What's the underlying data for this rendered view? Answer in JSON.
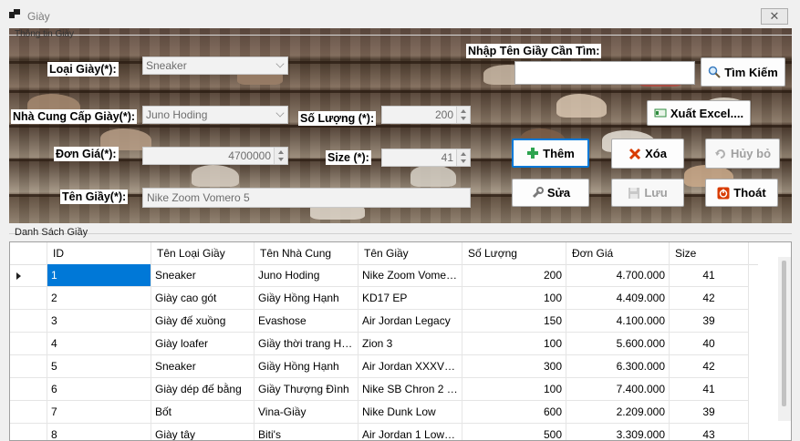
{
  "window": {
    "title": "Giày",
    "close_label": "✕"
  },
  "info_group": {
    "title": "Thông tin Giày"
  },
  "form": {
    "loai_giay_label": "Loại Giày(*):",
    "loai_giay_value": "Sneaker",
    "nha_cung_cap_label": "Nhà Cung Cấp Giày(*):",
    "nha_cung_cap_value": "Juno Hoding",
    "so_luong_label": "Số Lượng (*):",
    "so_luong_value": "200",
    "don_gia_label": "Đơn Giá(*):",
    "don_gia_value": "4700000",
    "size_label": "Size (*):",
    "size_value": "41",
    "ten_giay_label": "Tên Giầy(*):",
    "ten_giay_value": "Nike Zoom Vomero 5"
  },
  "search": {
    "label": "Nhập Tên Giầy Cần Tìm:",
    "value": "",
    "button": "Tìm Kiếm"
  },
  "buttons": {
    "export": "Xuất Excel....",
    "add": "Thêm",
    "delete": "Xóa",
    "cancel": "Hủy bỏ",
    "edit": "Sửa",
    "save": "Lưu",
    "exit": "Thoát"
  },
  "colors": {
    "selection": "#0078d7",
    "add_icon": "#2ea44f",
    "delete_icon": "#d83b01",
    "exit_icon": "#d83b01"
  },
  "table": {
    "title": "Danh Sách Giầy",
    "columns": [
      "ID",
      "Tên Loại Giầy",
      "Tên Nhà Cung",
      "Tên Giầy",
      "Số Lượng",
      "Đơn Giá",
      "Size"
    ],
    "rows": [
      [
        "1",
        "Sneaker",
        "Juno Hoding",
        "Nike Zoom Vomer...",
        "200",
        "4.700.000",
        "41"
      ],
      [
        "2",
        "Giày cao gót",
        "Giầy Hồng Hạnh",
        "KD17 EP",
        "100",
        "4.409.000",
        "42"
      ],
      [
        "3",
        "Giày đế xuồng",
        "Evashose",
        "Air Jordan Legacy",
        "150",
        "4.100.000",
        "39"
      ],
      [
        "4",
        "Giày loafer",
        "Giầy thời trang Hạ...",
        "Zion 3",
        "100",
        "5.600.000",
        "40"
      ],
      [
        "5",
        "Sneaker",
        "Giầy Hồng Hạnh",
        "Air Jordan XXXVIII ...",
        "300",
        "6.300.000",
        "42"
      ],
      [
        "6",
        "Giày dép đế bằng",
        "Giầy Thượng Đình",
        "Nike SB Chron 2 C...",
        "100",
        "7.400.000",
        "41"
      ],
      [
        "7",
        "Bốt",
        "Vina-Giầy",
        "Nike Dunk Low",
        "600",
        "2.209.000",
        "39"
      ],
      [
        "8",
        "Giày tây",
        "Biti's",
        "Air Jordan 1 Low S...",
        "500",
        "3.309.000",
        "43"
      ]
    ]
  }
}
